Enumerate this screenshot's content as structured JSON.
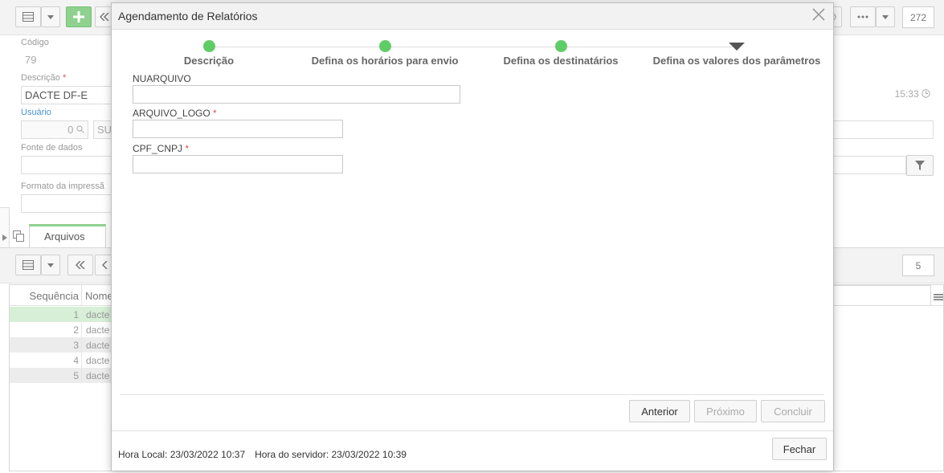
{
  "toolbar": {
    "add_icon": "plus-icon",
    "count": "272"
  },
  "form": {
    "codigo_label": "Código",
    "codigo_value": "79",
    "descricao_label": "Descrição",
    "descricao_value": "DACTE DF-E",
    "time_value": "15:33",
    "usuario_label": "Usuário",
    "usuario_value": "0",
    "usuario_extra": "SU",
    "fonte_label": "Fonte de dados",
    "formato_label": "Formato da impressã"
  },
  "tabs": {
    "arquivos": "Arquivos"
  },
  "toolbar2": {
    "count": "5"
  },
  "grid": {
    "col_sequencia": "Sequência",
    "col_nome": "Nome",
    "rows": [
      {
        "seq": "1",
        "nome": "dacte"
      },
      {
        "seq": "2",
        "nome": "dacte"
      },
      {
        "seq": "3",
        "nome": "dacte"
      },
      {
        "seq": "4",
        "nome": "dacte"
      },
      {
        "seq": "5",
        "nome": "dacte"
      }
    ]
  },
  "modal": {
    "title": "Agendamento de Relatórios",
    "steps": [
      {
        "label": "Descrição",
        "status": "done"
      },
      {
        "label": "Defina os horários para envio",
        "status": "done"
      },
      {
        "label": "Defina os destinatários",
        "status": "done"
      },
      {
        "label": "Defina os valores dos parâmetros",
        "status": "current"
      }
    ],
    "fields": [
      {
        "label": "NUARQUIVO",
        "required": false,
        "value": ""
      },
      {
        "label": "ARQUIVO_LOGO",
        "required": true,
        "value": ""
      },
      {
        "label": "CPF_CNPJ",
        "required": true,
        "value": ""
      }
    ],
    "buttons": {
      "anterior": "Anterior",
      "proximo": "Próximo",
      "concluir": "Concluir",
      "fechar": "Fechar"
    },
    "hora_local": "Hora Local: 23/03/2022 10:37",
    "hora_servidor": "Hora do servidor: 23/03/2022 10:39"
  },
  "colors": {
    "accent_green": "#5fcc66",
    "required_red": "#e05050"
  }
}
